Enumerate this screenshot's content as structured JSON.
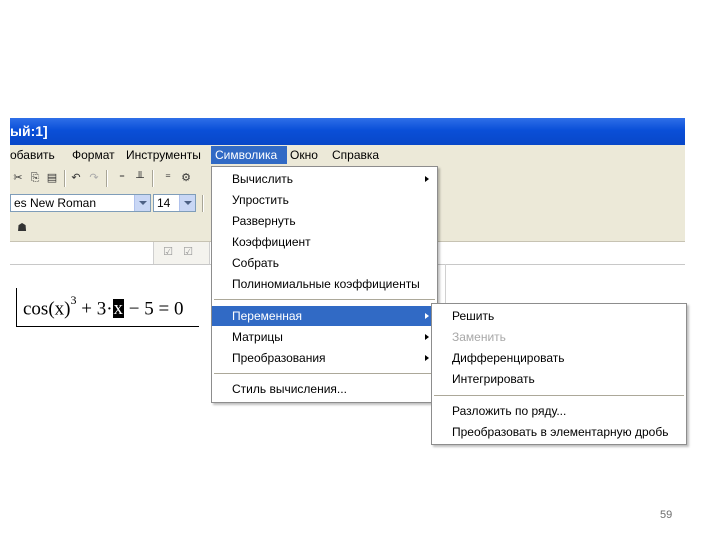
{
  "window": {
    "title": "ый:1]"
  },
  "menubar": {
    "items": [
      {
        "label": "обавить"
      },
      {
        "label": "Формат"
      },
      {
        "label": "Инструменты"
      },
      {
        "label": "Символика"
      },
      {
        "label": "Окно"
      },
      {
        "label": "Справка"
      }
    ],
    "active": "Символика"
  },
  "toolbar": {
    "font_name": "es New Roman",
    "font_size": "14",
    "icons": [
      "cut-icon",
      "copy-icon",
      "paste-icon",
      "undo-icon",
      "redo-icon",
      "align-icon",
      "align-bottom-icon",
      "calculate-icon",
      "resource-icon"
    ]
  },
  "worksheet": {
    "equation": {
      "part1": "cos(x)",
      "exp": "3",
      "part2": " + 3·",
      "cursor_var": "x",
      "part3": " − 5 = 0"
    }
  },
  "symbolics_menu": {
    "items": [
      {
        "label": "Вычислить",
        "submenu": true
      },
      {
        "label": "Упростить",
        "submenu": false
      },
      {
        "label": "Развернуть",
        "submenu": false
      },
      {
        "label": "Коэффициент",
        "submenu": false
      },
      {
        "label": "Собрать",
        "submenu": false
      },
      {
        "label": "Полиномиальные коэффициенты",
        "submenu": false
      },
      {
        "label": "Переменная",
        "submenu": true
      },
      {
        "label": "Матрицы",
        "submenu": true
      },
      {
        "label": "Преобразования",
        "submenu": true
      },
      {
        "label": "Стиль вычисления...",
        "submenu": false
      }
    ],
    "active": "Переменная"
  },
  "variable_submenu": {
    "items": [
      {
        "label": "Решить",
        "disabled": false
      },
      {
        "label": "Заменить",
        "disabled": true
      },
      {
        "label": "Дифференцировать",
        "disabled": false
      },
      {
        "label": "Интегрировать",
        "disabled": false
      },
      {
        "label": "Разложить по ряду...",
        "disabled": false
      },
      {
        "label": "Преобразовать в элементарную дробь",
        "disabled": false
      }
    ]
  },
  "page_number": "59",
  "colors": {
    "titlebar": "#0a4fd8",
    "menu_highlight": "#316ac5",
    "chrome": "#ece9d8"
  }
}
